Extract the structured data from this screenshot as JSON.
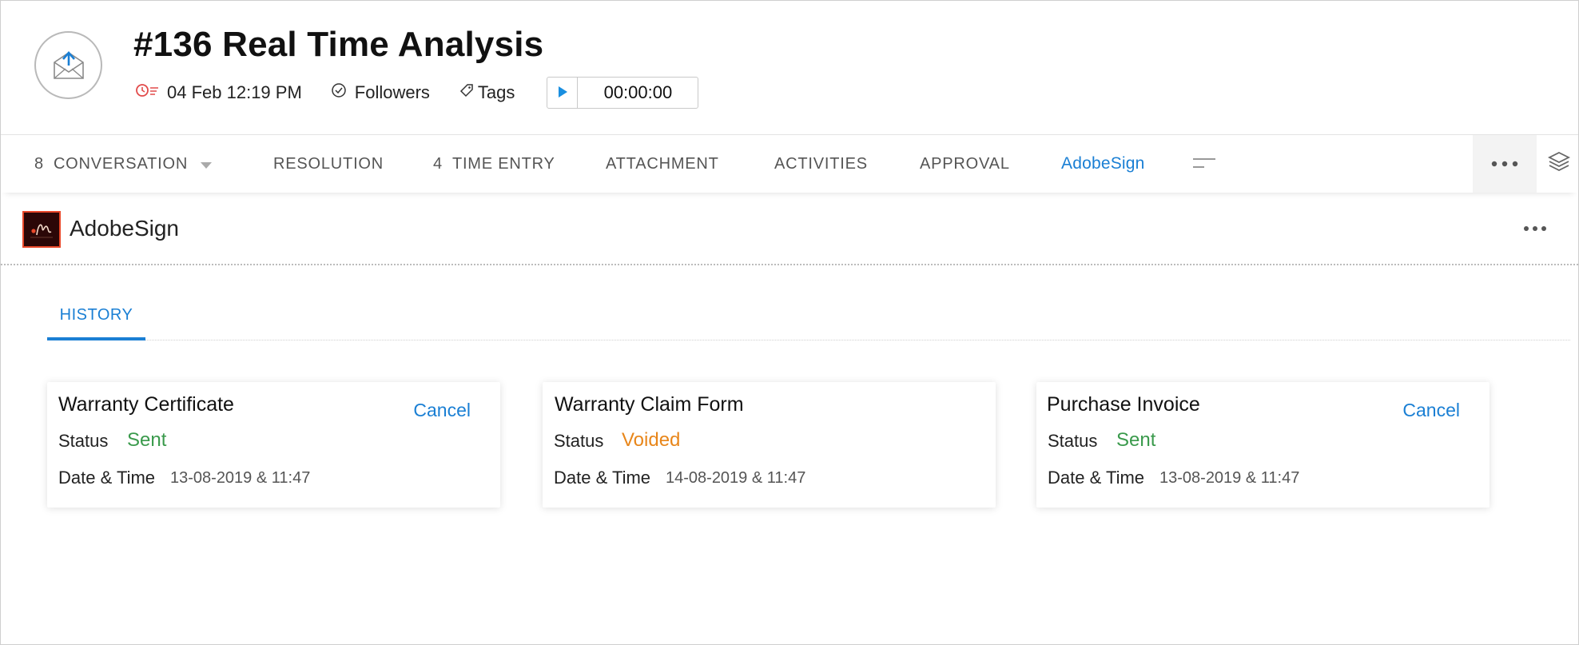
{
  "header": {
    "title": "#136 Real Time Analysis",
    "due_date": "04 Feb 12:19 PM",
    "followers_label": "Followers",
    "tags_label": "Tags",
    "timer_value": "00:00:00",
    "icons": [
      "envelope-upload-icon",
      "overdue-clock-icon",
      "check-circle-icon",
      "tag-icon",
      "play-icon"
    ]
  },
  "tabs": [
    {
      "count": "8",
      "label": "CONVERSATION",
      "has_dropdown": true
    },
    {
      "count": "",
      "label": "RESOLUTION"
    },
    {
      "count": "4",
      "label": "TIME ENTRY"
    },
    {
      "count": "",
      "label": "ATTACHMENT"
    },
    {
      "count": "",
      "label": "ACTIVITIES"
    },
    {
      "count": "",
      "label": "APPROVAL"
    },
    {
      "count": "",
      "label": "AdobeSign",
      "active": true
    }
  ],
  "app": {
    "name": "AdobeSign",
    "sub_tab": "HISTORY"
  },
  "cards": [
    {
      "title": "Warranty Certificate",
      "action": "Cancel",
      "status_label": "Status",
      "status": "Sent",
      "status_color": "#3a9a4c",
      "datetime_label": "Date & Time",
      "datetime": "13-08-2019 & 11:47"
    },
    {
      "title": "Warranty Claim Form",
      "action": "",
      "status_label": "Status",
      "status": "Voided",
      "status_color": "#e8861a",
      "datetime_label": "Date & Time",
      "datetime": "14-08-2019 & 11:47"
    },
    {
      "title": "Purchase Invoice",
      "action": "Cancel",
      "status_label": "Status",
      "status": "Sent",
      "status_color": "#3a9a4c",
      "datetime_label": "Date & Time",
      "datetime": "13-08-2019 & 11:47"
    }
  ],
  "colors": {
    "accent": "#1a7fd4",
    "sent": "#3a9a4c",
    "voided": "#e8861a",
    "overdue": "#e24b4b"
  }
}
